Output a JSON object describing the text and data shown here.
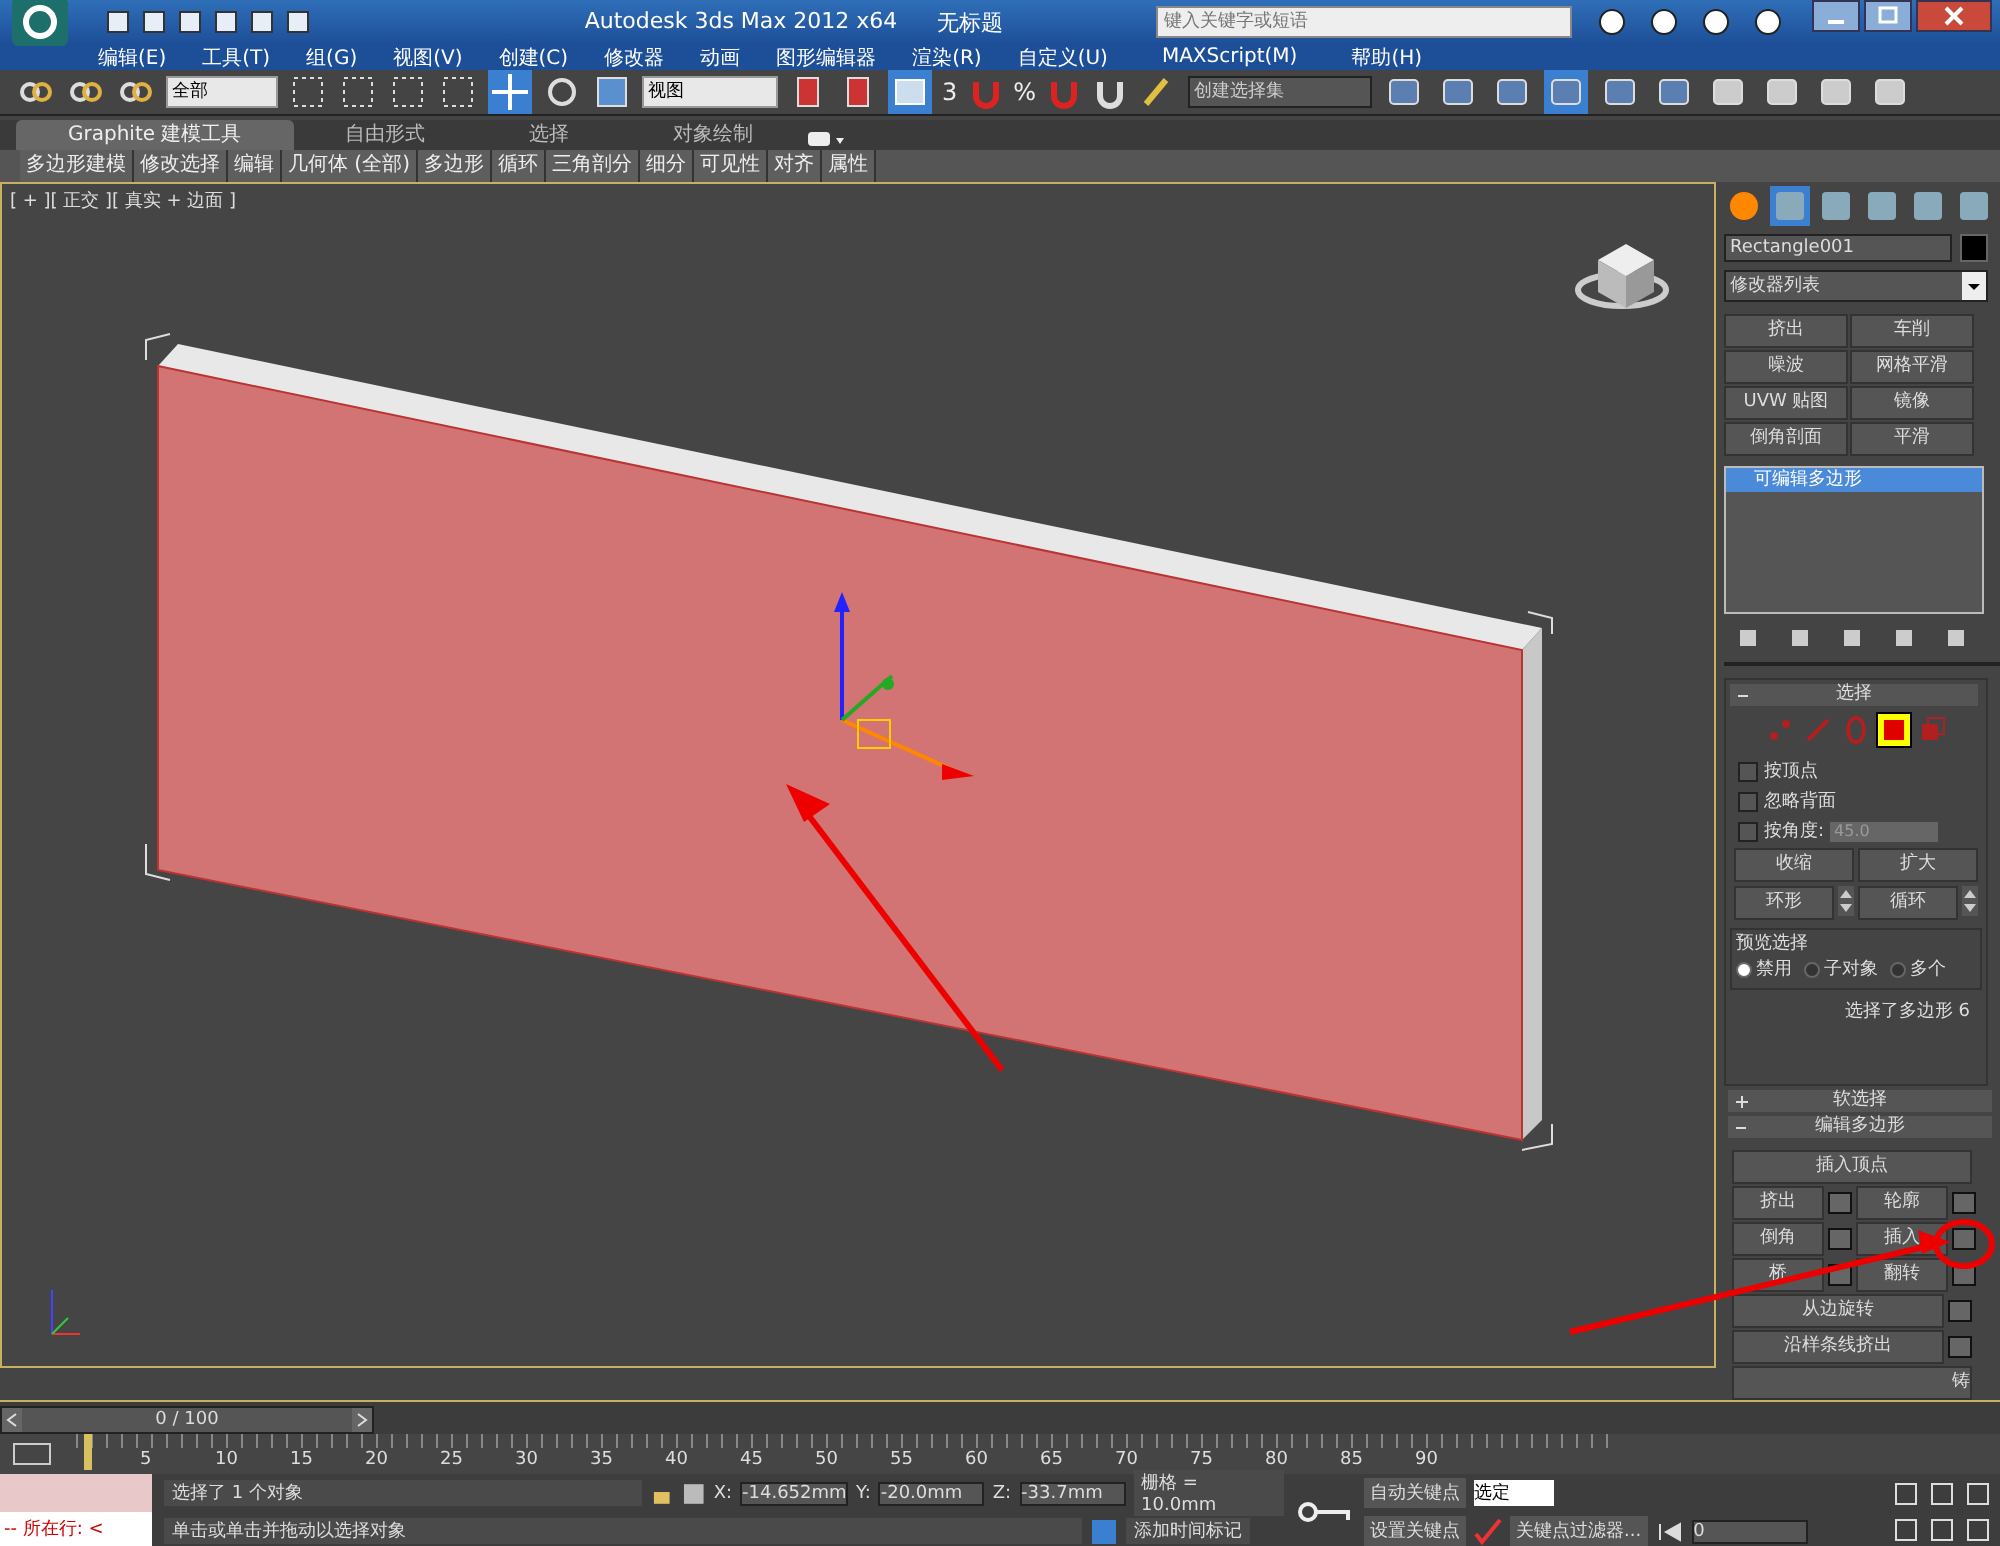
{
  "window": {
    "title": "Autodesk 3ds Max  2012 x64",
    "document": "无标题",
    "search": {
      "placeholder": "键入关键字或短语"
    }
  },
  "menu": [
    "编辑(E)",
    "工具(T)",
    "组(G)",
    "视图(V)",
    "创建(C)",
    "修改器",
    "动画",
    "图形编辑器",
    "渲染(R)",
    "自定义(U)",
    "MAXScript(M)",
    "帮助(H)"
  ],
  "toolbar": {
    "selection_filter": "全部",
    "coord_system": "视图",
    "snap_label": "3",
    "percent_label": "%",
    "named_selection": "创建选择集"
  },
  "ribbon": {
    "tabs": [
      {
        "label": "Graphite 建模工具",
        "selected": true
      },
      {
        "label": "自由形式",
        "selected": false
      },
      {
        "label": "选择",
        "selected": false
      },
      {
        "label": "对象绘制",
        "selected": false
      }
    ],
    "panels": [
      "多边形建模",
      "修改选择",
      "编辑",
      "几何体 (全部)",
      "多边形",
      "循环",
      "三角剖分",
      "细分",
      "可见性",
      "对齐",
      "属性"
    ]
  },
  "viewport": {
    "label": "[ + ][ 正交 ][ 真实 + 边面 ]"
  },
  "command_panel": {
    "object_name": "Rectangle001",
    "modifier_list": "修改器列表",
    "modifier_buttons": [
      "挤出",
      "车削",
      "噪波",
      "网格平滑",
      "UVW 贴图",
      "镜像",
      "倒角剖面",
      "平滑"
    ],
    "stack": [
      {
        "label": "可编辑多边形",
        "selected": true
      }
    ],
    "selection_rollout": {
      "title": "选择",
      "subobjects": [
        {
          "kind": "vertex",
          "selected": false
        },
        {
          "kind": "edge",
          "selected": false
        },
        {
          "kind": "border",
          "selected": false
        },
        {
          "kind": "polygon",
          "selected": true
        },
        {
          "kind": "element",
          "selected": false
        }
      ],
      "checkboxes": [
        {
          "label": "按顶点",
          "checked": false
        },
        {
          "label": "忽略背面",
          "checked": false
        },
        {
          "label": "按角度:",
          "checked": false
        }
      ],
      "angle_value": "45.0",
      "buttons": [
        "收缩",
        "扩大"
      ],
      "spin_buttons": [
        "环形",
        "循环"
      ],
      "preview_group": "预览选择",
      "preview_options": [
        {
          "label": "禁用",
          "selected": true
        },
        {
          "label": "子对象",
          "selected": false
        },
        {
          "label": "多个",
          "selected": false
        }
      ],
      "status": "选择了多边形 6"
    },
    "rollouts": [
      {
        "label": "软选择",
        "expanded": false
      },
      {
        "label": "编辑多边形",
        "expanded": true
      }
    ],
    "edit_polygon": {
      "insert_vertex": "插入顶点",
      "pairs": [
        [
          "挤出",
          "轮廓"
        ],
        [
          "倒角",
          "插入"
        ],
        [
          "桥",
          "翻转"
        ]
      ],
      "wide": [
        "从边旋转",
        "沿样条线挤出"
      ],
      "last": "铸"
    }
  },
  "timeline": {
    "frame": "0 / 100",
    "level": 0,
    "ticks": [
      "5",
      "10",
      "15",
      "20",
      "25",
      "30",
      "35",
      "40",
      "45",
      "50",
      "55",
      "60",
      "65",
      "70",
      "75",
      "80",
      "85",
      "90"
    ]
  },
  "status_bar": {
    "script_listener": "-- 所在行: <",
    "selection_info": "选择了 1 个对象",
    "prompt": "单击或单击并拖动以选择对象",
    "x_label": "X:",
    "x": "-14.652mm",
    "y_label": "Y:",
    "y": "-20.0mm",
    "z_label": "Z:",
    "z": "-33.7mm",
    "grid": "栅格 = 10.0mm",
    "add_time_tag": "添加时间标记",
    "auto_key": "自动关键点",
    "set_key": "设置关键点",
    "key_mode": "选定",
    "key_filters": "关键点过滤器...",
    "frame_value": "0"
  }
}
